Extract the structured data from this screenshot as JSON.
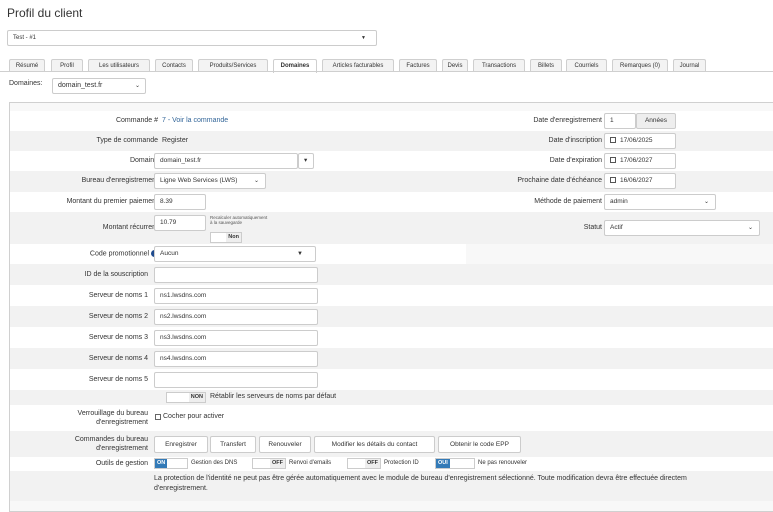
{
  "page": {
    "title": "Profil du client"
  },
  "client_select": {
    "value": "Test - #1"
  },
  "tabs": [
    {
      "label": "Résumé"
    },
    {
      "label": "Profil"
    },
    {
      "label": "Les utilisateurs"
    },
    {
      "label": "Contacts"
    },
    {
      "label": "Produits/Services"
    },
    {
      "label": "Domaines"
    },
    {
      "label": "Articles facturables"
    },
    {
      "label": "Factures"
    },
    {
      "label": "Devis"
    },
    {
      "label": "Transactions"
    },
    {
      "label": "Billets"
    },
    {
      "label": "Courriels"
    },
    {
      "label": "Remarques (0)"
    },
    {
      "label": "Journal"
    }
  ],
  "domains_filter": {
    "label": "Domaines:",
    "value": "domain_test.fr"
  },
  "form": {
    "order_label": "Commande #",
    "order_value": "7 - Voir la commande",
    "order_type_label": "Type de commande",
    "order_type_value": "Register",
    "domain_label": "Domaine",
    "domain_value": "domain_test.fr",
    "registrar_label": "Bureau d'enregistrement",
    "registrar_value": "Ligne Web Services (LWS)",
    "first_payment_label": "Montant du premier paiement",
    "first_payment_value": "8.39",
    "recurring_label": "Montant récurrent",
    "recurring_value": "10.79",
    "recalc_text": "Recalculer automatiquement à la sauvegarde",
    "recalc_toggle": "Non",
    "promo_label": "Code promotionnel",
    "promo_value": "Aucun",
    "subscription_label": "ID de la souscription",
    "subscription_value": "",
    "ns1_label": "Serveur de noms 1",
    "ns1_value": "ns1.lwsdns.com",
    "ns2_label": "Serveur de noms 2",
    "ns2_value": "ns2.lwsdns.com",
    "ns3_label": "Serveur de noms 3",
    "ns3_value": "ns3.lwsdns.com",
    "ns4_label": "Serveur de noms 4",
    "ns4_value": "ns4.lwsdns.com",
    "ns5_label": "Serveur de noms 5",
    "ns5_value": "",
    "reset_ns_toggle": "NON",
    "reset_ns_text": "Rétablir les serveurs de noms par défaut",
    "lock_label_1": "Verrouillage du bureau",
    "lock_label_2": "d'enregistrement",
    "lock_checkbox_text": "Cocher pour activer",
    "commands_label_1": "Commandes du bureau",
    "commands_label_2": "d'enregistrement",
    "commands": [
      "Enregistrer",
      "Transfert",
      "Renouveler",
      "Modifier les détails du contact",
      "Obtenir le code EPP"
    ],
    "mgmt_label": "Outils de gestion",
    "mgmt": [
      {
        "state": "ON",
        "label": "Gestion des DNS"
      },
      {
        "state": "OFF",
        "label": "Renvoi d'emails"
      },
      {
        "state": "OFF",
        "label": "Protection ID"
      },
      {
        "state": "OUI",
        "label": "Ne pas renouveler"
      }
    ],
    "id_protection_note": "La protection de l'identité ne peut pas être gérée automatiquement avec le module de bureau d'enregistrement sélectionné. Toute modification devra être effectuée directem",
    "id_protection_note_2": "d'enregistrement."
  },
  "right": {
    "reg_date_label": "Date d'enregistrement",
    "reg_years": "1",
    "reg_years_unit": "Années",
    "signup_label": "Date d'inscription",
    "signup_value": "17/06/2025",
    "expiry_label": "Date d'expiration",
    "expiry_value": "17/06/2027",
    "next_due_label": "Prochaine date d'échéance",
    "next_due_value": "16/06/2027",
    "payment_method_label": "Méthode de paiement",
    "payment_method_value": "admin",
    "status_label": "Statut",
    "status_value": "Actif"
  },
  "colors": {
    "accent": "#337ab7",
    "link": "#336699",
    "panel_bg": "#f8f8f8"
  }
}
